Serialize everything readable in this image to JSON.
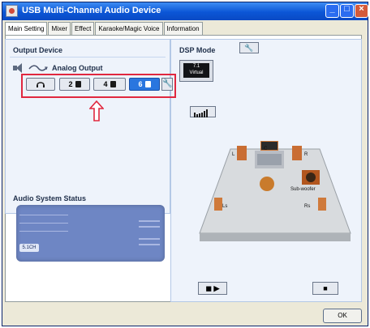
{
  "window": {
    "title": "USB Multi-Channel Audio Device",
    "controls": {
      "minimize_icon": "minimize-icon",
      "maximize_icon": "maximize-icon",
      "close_icon": "close-icon"
    }
  },
  "tabs": [
    {
      "label": "Main Setting",
      "active": true
    },
    {
      "label": "Mixer",
      "active": false
    },
    {
      "label": "Effect",
      "active": false
    },
    {
      "label": "Karaoke/Magic Voice",
      "active": false
    },
    {
      "label": "Information",
      "active": false
    }
  ],
  "output_device": {
    "section_title": "Output Device",
    "output_label": "Analog Output",
    "buttons": [
      {
        "label": "",
        "icon": "headphones-icon",
        "selected": false
      },
      {
        "label": "2",
        "icon": "speaker-icon",
        "selected": false
      },
      {
        "label": "4",
        "icon": "speaker-icon",
        "selected": false
      },
      {
        "label": "6",
        "icon": "speaker-icon",
        "selected": true
      }
    ],
    "highlight_color": "#e0283f",
    "selected_color": "#2a76df"
  },
  "audio_status": {
    "section_title": "Audio System Status",
    "channel_label": "5.1CH"
  },
  "dsp": {
    "section_title": "DSP Mode",
    "mode_line1": "7.1",
    "mode_line2": "Virtual"
  },
  "speakers": {
    "center": "C",
    "left": "L",
    "right": "R",
    "subwoofer": "Sub-woofer",
    "left_surround": "Ls",
    "right_surround": "Rs"
  },
  "buttons": {
    "ok_label": "OK"
  }
}
